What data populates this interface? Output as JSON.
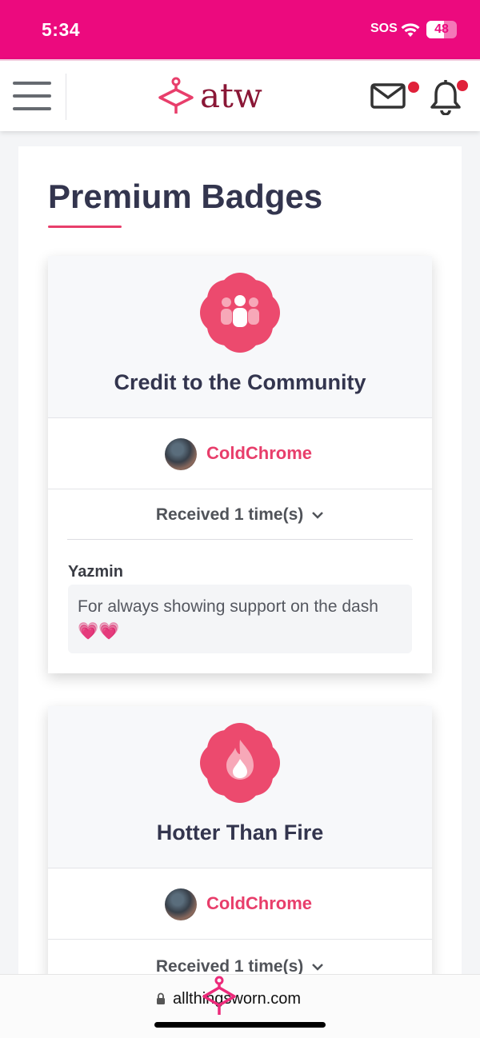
{
  "status_bar": {
    "time": "5:34",
    "sos": "SOS",
    "battery_level": "48"
  },
  "header": {
    "logo_text": "atw"
  },
  "page": {
    "title": "Premium Badges"
  },
  "badges": [
    {
      "name": "Credit to the Community",
      "icon": "community-icon",
      "recipient": "ColdChrome",
      "received_label": "Received 1 time(s)",
      "giver": "Yazmin",
      "message": "For always showing support on the dash 💗💗"
    },
    {
      "name": "Hotter Than Fire",
      "icon": "fire-icon",
      "recipient": "ColdChrome",
      "received_label": "Received 1 time(s)"
    }
  ],
  "browser": {
    "url": "allthingsworn.com"
  },
  "colors": {
    "brand_pink": "#ec0a7e",
    "accent": "#e83e6b",
    "logo_dark": "#8a1736"
  }
}
